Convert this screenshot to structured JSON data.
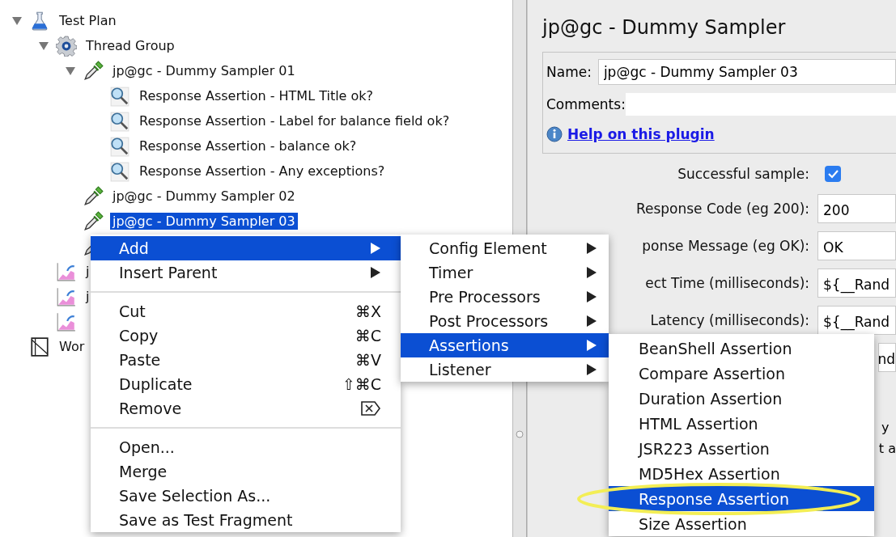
{
  "tree": [
    {
      "label": "Test Plan",
      "kind": "test-plan",
      "expanded": true,
      "selected": false,
      "children": [
        {
          "label": "Thread Group",
          "kind": "thread-group",
          "expanded": true,
          "selected": false,
          "children": [
            {
              "label": "jp@gc - Dummy Sampler 01",
              "kind": "sampler",
              "expanded": true,
              "selected": false,
              "children": [
                {
                  "label": "Response Assertion - HTML Title ok?",
                  "kind": "assertion",
                  "selected": false
                },
                {
                  "label": "Response Assertion - Label for balance field ok?",
                  "kind": "assertion",
                  "selected": false
                },
                {
                  "label": "Response Assertion - balance ok?",
                  "kind": "assertion",
                  "selected": false
                },
                {
                  "label": "Response Assertion - Any exceptions?",
                  "kind": "assertion",
                  "selected": false
                }
              ]
            },
            {
              "label": "jp@gc - Dummy Sampler 02",
              "kind": "sampler",
              "selected": false
            },
            {
              "label": "jp@gc - Dummy Sampler 03",
              "kind": "sampler",
              "selected": true
            },
            {
              "kind": "sampler"
            }
          ]
        },
        {
          "label": "j",
          "kind": "listener",
          "selected": false
        },
        {
          "label": "j",
          "kind": "listener",
          "selected": false
        },
        {
          "kind": "listener"
        }
      ]
    },
    {
      "label": "Wor",
      "kind": "workbench",
      "selected": false
    }
  ],
  "editor": {
    "title": "jp@gc - Dummy Sampler",
    "name_label": "Name:",
    "name_value": "jp@gc - Dummy Sampler 03",
    "comments_label": "Comments:",
    "help_link": "Help on this plugin",
    "fields": [
      {
        "kind": "checkbox",
        "label": "Successful sample:",
        "checked": true
      },
      {
        "kind": "text",
        "label": "Response Code (eg 200):",
        "value": "200"
      },
      {
        "kind": "text",
        "label": "ponse Message (eg OK):",
        "value": "OK"
      },
      {
        "kind": "text",
        "label": "ect Time (milliseconds):",
        "value": "${__Rand"
      },
      {
        "kind": "text",
        "label": "Latency (milliseconds):",
        "value": "${__Rand"
      },
      {
        "kind": "text-end",
        "value": "nd"
      }
    ],
    "fragments": [
      "y",
      "t a"
    ]
  },
  "context_menu": [
    {
      "kind": "item",
      "label": "Add",
      "submenu": true,
      "selected": true
    },
    {
      "kind": "item",
      "label": "Insert Parent",
      "submenu": true,
      "selected": false
    },
    {
      "kind": "separator"
    },
    {
      "kind": "item",
      "label": "Cut",
      "shortcut": "⌘X",
      "selected": false
    },
    {
      "kind": "item",
      "label": "Copy",
      "shortcut": "⌘C",
      "selected": false
    },
    {
      "kind": "item",
      "label": "Paste",
      "shortcut": "⌘V",
      "selected": false
    },
    {
      "kind": "item",
      "label": "Duplicate",
      "shortcut": "⇧⌘C",
      "selected": false
    },
    {
      "kind": "item",
      "label": "Remove",
      "delete_key": true,
      "selected": false
    },
    {
      "kind": "separator"
    },
    {
      "kind": "item",
      "label": "Open...",
      "selected": false
    },
    {
      "kind": "item",
      "label": "Merge",
      "selected": false
    },
    {
      "kind": "item",
      "label": "Save Selection As...",
      "selected": false
    },
    {
      "kind": "item",
      "label": "Save as Test Fragment",
      "selected": false
    }
  ],
  "add_menu": [
    {
      "label": "Config Element",
      "selected": false
    },
    {
      "label": "Timer",
      "selected": false
    },
    {
      "label": "Pre Processors",
      "selected": false
    },
    {
      "label": "Post Processors",
      "selected": false
    },
    {
      "label": "Assertions",
      "selected": true
    },
    {
      "label": "Listener",
      "selected": false
    }
  ],
  "assertions_menu": [
    {
      "label": "BeanShell Assertion",
      "selected": false
    },
    {
      "label": "Compare Assertion",
      "selected": false
    },
    {
      "label": "Duration Assertion",
      "selected": false
    },
    {
      "label": "HTML Assertion",
      "selected": false
    },
    {
      "label": "JSR223 Assertion",
      "selected": false
    },
    {
      "label": "MD5Hex Assertion",
      "selected": false
    },
    {
      "label": "Response Assertion",
      "selected": true,
      "highlighted": true
    },
    {
      "label": "Size Assertion",
      "selected": false
    }
  ]
}
